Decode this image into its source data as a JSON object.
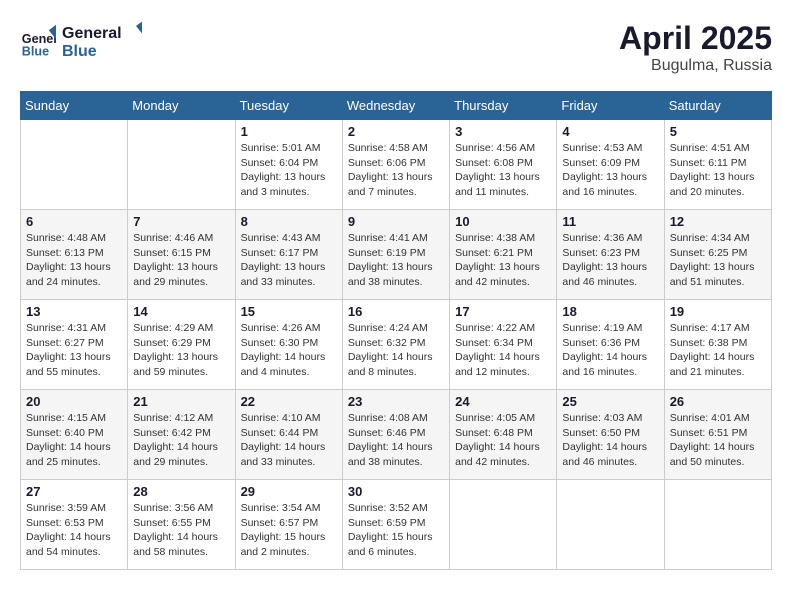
{
  "header": {
    "logo_line1": "General",
    "logo_line2": "Blue",
    "month_title": "April 2025",
    "location": "Bugulma, Russia"
  },
  "weekdays": [
    "Sunday",
    "Monday",
    "Tuesday",
    "Wednesday",
    "Thursday",
    "Friday",
    "Saturday"
  ],
  "weeks": [
    [
      null,
      null,
      {
        "day": "1",
        "sunrise": "5:01 AM",
        "sunset": "6:04 PM",
        "daylight": "13 hours and 3 minutes."
      },
      {
        "day": "2",
        "sunrise": "4:58 AM",
        "sunset": "6:06 PM",
        "daylight": "13 hours and 7 minutes."
      },
      {
        "day": "3",
        "sunrise": "4:56 AM",
        "sunset": "6:08 PM",
        "daylight": "13 hours and 11 minutes."
      },
      {
        "day": "4",
        "sunrise": "4:53 AM",
        "sunset": "6:09 PM",
        "daylight": "13 hours and 16 minutes."
      },
      {
        "day": "5",
        "sunrise": "4:51 AM",
        "sunset": "6:11 PM",
        "daylight": "13 hours and 20 minutes."
      }
    ],
    [
      {
        "day": "6",
        "sunrise": "4:48 AM",
        "sunset": "6:13 PM",
        "daylight": "13 hours and 24 minutes."
      },
      {
        "day": "7",
        "sunrise": "4:46 AM",
        "sunset": "6:15 PM",
        "daylight": "13 hours and 29 minutes."
      },
      {
        "day": "8",
        "sunrise": "4:43 AM",
        "sunset": "6:17 PM",
        "daylight": "13 hours and 33 minutes."
      },
      {
        "day": "9",
        "sunrise": "4:41 AM",
        "sunset": "6:19 PM",
        "daylight": "13 hours and 38 minutes."
      },
      {
        "day": "10",
        "sunrise": "4:38 AM",
        "sunset": "6:21 PM",
        "daylight": "13 hours and 42 minutes."
      },
      {
        "day": "11",
        "sunrise": "4:36 AM",
        "sunset": "6:23 PM",
        "daylight": "13 hours and 46 minutes."
      },
      {
        "day": "12",
        "sunrise": "4:34 AM",
        "sunset": "6:25 PM",
        "daylight": "13 hours and 51 minutes."
      }
    ],
    [
      {
        "day": "13",
        "sunrise": "4:31 AM",
        "sunset": "6:27 PM",
        "daylight": "13 hours and 55 minutes."
      },
      {
        "day": "14",
        "sunrise": "4:29 AM",
        "sunset": "6:29 PM",
        "daylight": "13 hours and 59 minutes."
      },
      {
        "day": "15",
        "sunrise": "4:26 AM",
        "sunset": "6:30 PM",
        "daylight": "14 hours and 4 minutes."
      },
      {
        "day": "16",
        "sunrise": "4:24 AM",
        "sunset": "6:32 PM",
        "daylight": "14 hours and 8 minutes."
      },
      {
        "day": "17",
        "sunrise": "4:22 AM",
        "sunset": "6:34 PM",
        "daylight": "14 hours and 12 minutes."
      },
      {
        "day": "18",
        "sunrise": "4:19 AM",
        "sunset": "6:36 PM",
        "daylight": "14 hours and 16 minutes."
      },
      {
        "day": "19",
        "sunrise": "4:17 AM",
        "sunset": "6:38 PM",
        "daylight": "14 hours and 21 minutes."
      }
    ],
    [
      {
        "day": "20",
        "sunrise": "4:15 AM",
        "sunset": "6:40 PM",
        "daylight": "14 hours and 25 minutes."
      },
      {
        "day": "21",
        "sunrise": "4:12 AM",
        "sunset": "6:42 PM",
        "daylight": "14 hours and 29 minutes."
      },
      {
        "day": "22",
        "sunrise": "4:10 AM",
        "sunset": "6:44 PM",
        "daylight": "14 hours and 33 minutes."
      },
      {
        "day": "23",
        "sunrise": "4:08 AM",
        "sunset": "6:46 PM",
        "daylight": "14 hours and 38 minutes."
      },
      {
        "day": "24",
        "sunrise": "4:05 AM",
        "sunset": "6:48 PM",
        "daylight": "14 hours and 42 minutes."
      },
      {
        "day": "25",
        "sunrise": "4:03 AM",
        "sunset": "6:50 PM",
        "daylight": "14 hours and 46 minutes."
      },
      {
        "day": "26",
        "sunrise": "4:01 AM",
        "sunset": "6:51 PM",
        "daylight": "14 hours and 50 minutes."
      }
    ],
    [
      {
        "day": "27",
        "sunrise": "3:59 AM",
        "sunset": "6:53 PM",
        "daylight": "14 hours and 54 minutes."
      },
      {
        "day": "28",
        "sunrise": "3:56 AM",
        "sunset": "6:55 PM",
        "daylight": "14 hours and 58 minutes."
      },
      {
        "day": "29",
        "sunrise": "3:54 AM",
        "sunset": "6:57 PM",
        "daylight": "15 hours and 2 minutes."
      },
      {
        "day": "30",
        "sunrise": "3:52 AM",
        "sunset": "6:59 PM",
        "daylight": "15 hours and 6 minutes."
      },
      null,
      null,
      null
    ]
  ]
}
